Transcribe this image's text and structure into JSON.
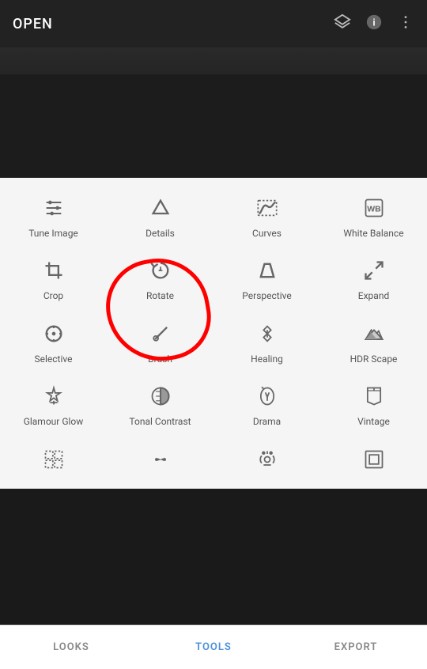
{
  "header": {
    "title": "OPEN",
    "icons": [
      "layers-icon",
      "info-icon",
      "more-icon"
    ]
  },
  "tools": [
    {
      "id": "tune-image",
      "label": "Tune Image",
      "icon": "sliders"
    },
    {
      "id": "details",
      "label": "Details",
      "icon": "triangle"
    },
    {
      "id": "curves",
      "label": "Curves",
      "icon": "curves"
    },
    {
      "id": "white-balance",
      "label": "White Balance",
      "icon": "wb"
    },
    {
      "id": "crop",
      "label": "Crop",
      "icon": "crop"
    },
    {
      "id": "rotate",
      "label": "Rotate",
      "icon": "rotate"
    },
    {
      "id": "perspective",
      "label": "Perspective",
      "icon": "perspective"
    },
    {
      "id": "expand",
      "label": "Expand",
      "icon": "expand"
    },
    {
      "id": "selective",
      "label": "Selective",
      "icon": "selective"
    },
    {
      "id": "brush",
      "label": "Brush",
      "icon": "brush"
    },
    {
      "id": "healing",
      "label": "Healing",
      "icon": "healing"
    },
    {
      "id": "hdr-scape",
      "label": "HDR Scape",
      "icon": "hdr"
    },
    {
      "id": "glamour-glow",
      "label": "Glamour Glow",
      "icon": "glamour"
    },
    {
      "id": "tonal-contrast",
      "label": "Tonal Contrast",
      "icon": "tonal"
    },
    {
      "id": "drama",
      "label": "Drama",
      "icon": "drama"
    },
    {
      "id": "vintage",
      "label": "Vintage",
      "icon": "vintage"
    },
    {
      "id": "grunge",
      "label": "",
      "icon": "grunge"
    },
    {
      "id": "face",
      "label": "",
      "icon": "face"
    },
    {
      "id": "retrosavanna",
      "label": "",
      "icon": "retro"
    },
    {
      "id": "frames",
      "label": "",
      "icon": "frames"
    }
  ],
  "bottom_nav": [
    {
      "id": "looks",
      "label": "LOOKS",
      "active": false
    },
    {
      "id": "tools",
      "label": "TOOLS",
      "active": true
    },
    {
      "id": "export",
      "label": "EXPORT",
      "active": false
    }
  ]
}
